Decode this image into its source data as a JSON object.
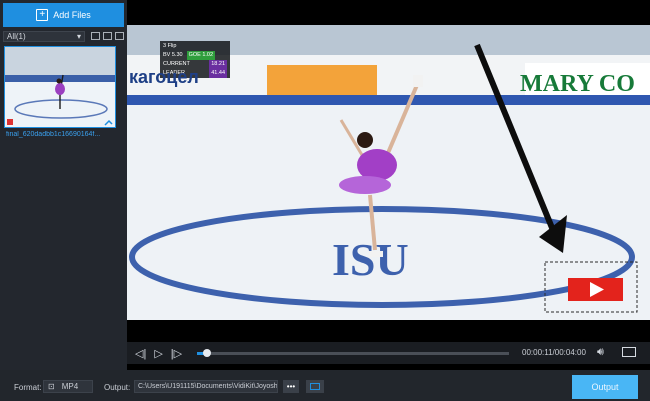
{
  "sidebar": {
    "add_files_label": "Add Files",
    "filter_value": "All(1)",
    "file_name": "final_620dadbb1c16690164f..."
  },
  "video": {
    "score_overlay": {
      "element": "3 Flip",
      "bv": "BV 5.30",
      "goe": "GOE 1.02",
      "current_label": "CURRENT",
      "current_value": "18.21",
      "leader_label": "LEADER",
      "leader_value": "41.44"
    },
    "board_text_left": "кагоцел",
    "board_text_right": "MARY CO"
  },
  "player": {
    "progress_fraction": 0.032,
    "time_display": "00:00:11/00:04:00"
  },
  "bottom": {
    "format_label": "Format:",
    "format_value": "MP4",
    "output_label": "Output:",
    "output_path": "C:\\Users\\U191115\\Documents\\VidiKit\\Joyosh",
    "more_label": "•••",
    "output_button": "Output"
  },
  "colors": {
    "accent": "#1f8fe0",
    "output_button": "#49b6f5",
    "youtube_red": "#e3231c"
  }
}
